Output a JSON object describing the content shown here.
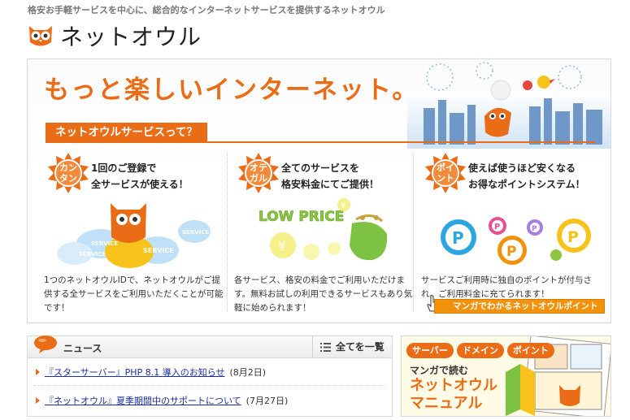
{
  "header": {
    "tagline": "格安お手軽サービスを中心に、総合的なインターネットサービスを提供するネットオウル",
    "logo_text": "ネットオウル"
  },
  "hero": {
    "headline": "もっと楽しいインターネット。",
    "section_tag": "ネットオウルサービスって？",
    "columns": [
      {
        "badge": "カン\nタン",
        "title": "1回のご登録で\n全サービスが使える！",
        "services": [
          "SERVICE",
          "SERVICE",
          "SERVICE",
          "SERVICE"
        ],
        "description": "1つのネットオウルIDで、ネットオウルがご提供する全サービスをご利用いただくことが可能です！"
      },
      {
        "badge": "オテ\nガル",
        "title": "全てのサービスを\n格安料金にてご提供！",
        "illustration_text": "LOW PRICE",
        "description": "各サービス、格安の料金でご利用いただけます。無料お試しの利用できるサービスもあり気軽に始められます！"
      },
      {
        "badge": "ポイ\nント",
        "title": "使えば使うほど安くなる\nお得なポイントシステム！",
        "description": "サービスご利用時に独自のポイントが付与され、ご利用料金に充てられます！"
      }
    ],
    "manga_link": "マンガでわかるネットオウルポイント"
  },
  "news": {
    "title": "ニュース",
    "all_label": "全てを一覧",
    "items": [
      {
        "text": "『スターサーバー』PHP 8.1 導入のお知らせ",
        "date": "(8月2日)"
      },
      {
        "text": "『ネットオウル』夏季期間中のサポートについて",
        "date": "(7月27日)"
      }
    ]
  },
  "manual": {
    "tabs": [
      "サーバー",
      "ドメイン",
      "ポイント"
    ],
    "subtitle": "マンガで読む",
    "title": "ネットオウル\nマニュアル"
  },
  "colors": {
    "brand_orange": "#ea6c16",
    "link_blue": "#1a2fa0",
    "button_orange": "#f2920c"
  },
  "icons": [
    "owl-logo-icon",
    "bubble-icon",
    "list-icon",
    "cursor-hand-icon",
    "coin-icon",
    "purse-icon"
  ]
}
